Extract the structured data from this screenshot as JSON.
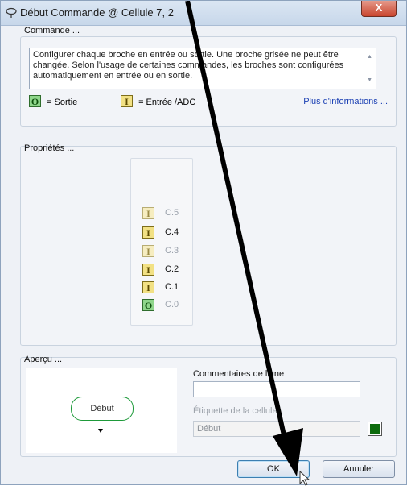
{
  "window": {
    "title": "Début Commande @ Cellule 7, 2",
    "close_label": "X"
  },
  "commande": {
    "label": "Commande ...",
    "description": "Configurer chaque broche en entrée ou sortie. Une broche grisée ne peut être changée. Selon l'usage de certaines commandes, les broches sont configurées automatiquement en entrée ou en sortie.",
    "legend": [
      {
        "badge": "O",
        "text": "= Sortie",
        "kind": "out"
      },
      {
        "badge": "I",
        "text": "= Entrée /ADC",
        "kind": "in"
      }
    ],
    "more_info_link": "Plus d'informations ..."
  },
  "proprietes": {
    "label": "Propriétés ...",
    "pins": [
      {
        "badge": "I",
        "label": "C.5",
        "kind": "in",
        "disabled": true
      },
      {
        "badge": "I",
        "label": "C.4",
        "kind": "in",
        "disabled": false
      },
      {
        "badge": "I",
        "label": "C.3",
        "kind": "in",
        "disabled": true
      },
      {
        "badge": "I",
        "label": "C.2",
        "kind": "in",
        "disabled": false
      },
      {
        "badge": "I",
        "label": "C.1",
        "kind": "in",
        "disabled": false
      },
      {
        "badge": "O",
        "label": "C.0",
        "kind": "out",
        "disabled": true
      }
    ]
  },
  "apercu": {
    "label": "Aperçu ...",
    "node_label": "Début",
    "line_comments_label": "Commentaires de ligne",
    "line_comments_value": "",
    "cell_label_label": "Étiquette de la cellule",
    "cell_label_value": "Début",
    "swatch_color": "#0d6b0d"
  },
  "buttons": {
    "ok": "OK",
    "cancel": "Annuler"
  },
  "colors": {
    "output_green": "#8fd68b",
    "input_yellow": "#f2e184",
    "link_blue": "#1a3fb3"
  }
}
